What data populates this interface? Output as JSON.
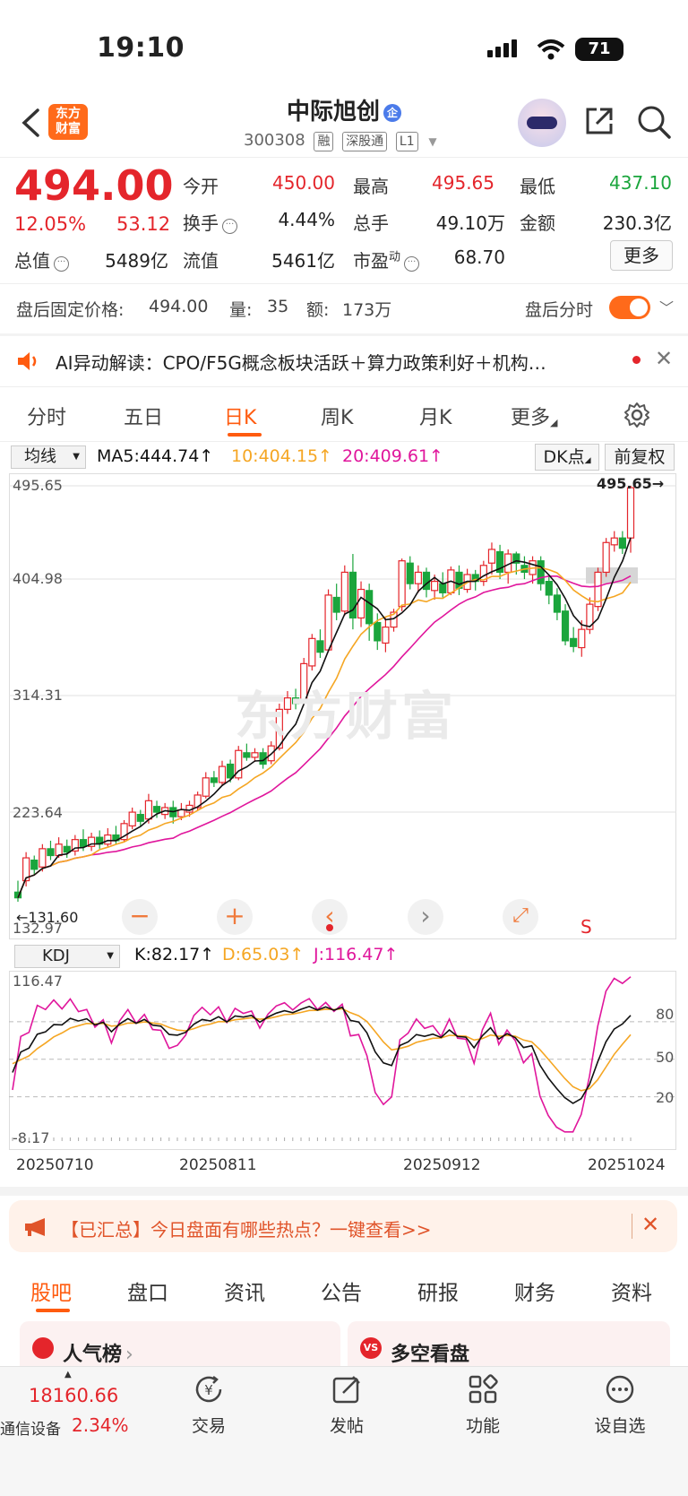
{
  "status_bar": {
    "time": "19:10",
    "battery": "71"
  },
  "header": {
    "stock_name": "中际旭创",
    "badge": "企",
    "code": "300308",
    "tags": [
      "融",
      "深股通",
      "L1"
    ],
    "logo_line1": "东方",
    "logo_line2": "财富"
  },
  "quote": {
    "price": "494.00",
    "change_pct": "12.05%",
    "change": "53.12",
    "open_label": "今开",
    "open": "450.00",
    "high_label": "最高",
    "high": "495.65",
    "low_label": "最低",
    "low": "437.10",
    "turnover_label": "换手",
    "turnover": "4.44%",
    "volume_label": "总手",
    "volume": "49.10万",
    "amount_label": "金额",
    "amount": "230.3亿",
    "mktcap_label": "总值",
    "mktcap": "5489亿",
    "float_label": "流值",
    "float": "5461亿",
    "pe_label": "市盈",
    "pe_sup": "动",
    "pe": "68.70",
    "more_button": "更多"
  },
  "after_hours": {
    "price_label": "盘后固定价格:",
    "price": "494.00",
    "vol_label": "量:",
    "vol": "35",
    "amt_label": "额:",
    "amt": "173万",
    "toggle_label": "盘后分时"
  },
  "ai_bar": {
    "text": "AI异动解读：CPO/F5G概念板块活跃＋算力政策利好＋机构…"
  },
  "chart_tabs": [
    "分时",
    "五日",
    "日K",
    "周K",
    "月K",
    "更多"
  ],
  "chart_header": {
    "ma_select": "均线",
    "ma5": "MA5:444.74↑",
    "ma10": "10:404.15↑",
    "ma20": "20:409.61↑",
    "dk_button": "DK点",
    "adjust_button": "前复权"
  },
  "price_axis": [
    "495.65",
    "404.98",
    "314.31",
    "223.64",
    "132.97"
  ],
  "high_marker": "495.65→",
  "low_marker": "←131.60",
  "watermark": "东方财富",
  "s_marker": "S",
  "kdj_header": {
    "select": "KDJ",
    "k": "K:82.17↑",
    "d": "D:65.03↑",
    "j": "J:116.47↑"
  },
  "kdj_axis": {
    "top": "116.47",
    "bottom": "-8.17",
    "levels": [
      "80",
      "50",
      "20"
    ]
  },
  "dates": [
    "20250710",
    "20250811",
    "20250912",
    "20251024"
  ],
  "banner": {
    "text": "【已汇总】今日盘面有哪些热点？一键查看>>"
  },
  "bottom_tabs": [
    "股吧",
    "盘口",
    "资讯",
    "公告",
    "研报",
    "财务",
    "资料"
  ],
  "cards": {
    "left": "人气榜",
    "right": "多空看盘"
  },
  "bottom_nav": {
    "index_value": "18160.66",
    "index_name": "通信设备",
    "index_pct": "2.34%",
    "items": [
      "交易",
      "发帖",
      "功能",
      "设自选"
    ]
  },
  "colors": {
    "up": "#e4252b",
    "down": "#1aa53c",
    "accent": "#ff5b0f",
    "ma5": "#111111",
    "ma10": "#f5a623",
    "ma20": "#e0169c"
  },
  "chart_data": {
    "type": "candlestick",
    "ylim": [
      131.6,
      495.65
    ],
    "candles": [
      {
        "o": 140,
        "c": 135,
        "h": 150,
        "l": 131.6
      },
      {
        "o": 150,
        "c": 170,
        "h": 175,
        "l": 145
      },
      {
        "o": 168,
        "c": 160,
        "h": 172,
        "l": 155
      },
      {
        "o": 162,
        "c": 178,
        "h": 182,
        "l": 158
      },
      {
        "o": 178,
        "c": 172,
        "h": 185,
        "l": 168
      },
      {
        "o": 172,
        "c": 182,
        "h": 188,
        "l": 170
      },
      {
        "o": 180,
        "c": 175,
        "h": 186,
        "l": 170
      },
      {
        "o": 176,
        "c": 186,
        "h": 190,
        "l": 172
      },
      {
        "o": 186,
        "c": 180,
        "h": 195,
        "l": 176
      },
      {
        "o": 180,
        "c": 188,
        "h": 192,
        "l": 176
      },
      {
        "o": 188,
        "c": 182,
        "h": 194,
        "l": 178
      },
      {
        "o": 182,
        "c": 190,
        "h": 196,
        "l": 180
      },
      {
        "o": 190,
        "c": 185,
        "h": 198,
        "l": 182
      },
      {
        "o": 186,
        "c": 200,
        "h": 203,
        "l": 184
      },
      {
        "o": 198,
        "c": 210,
        "h": 214,
        "l": 195
      },
      {
        "o": 208,
        "c": 202,
        "h": 212,
        "l": 198
      },
      {
        "o": 204,
        "c": 220,
        "h": 226,
        "l": 200
      },
      {
        "o": 215,
        "c": 210,
        "h": 220,
        "l": 205
      },
      {
        "o": 208,
        "c": 214,
        "h": 218,
        "l": 204
      },
      {
        "o": 214,
        "c": 206,
        "h": 220,
        "l": 200
      },
      {
        "o": 206,
        "c": 212,
        "h": 218,
        "l": 203
      },
      {
        "o": 210,
        "c": 216,
        "h": 220,
        "l": 206
      },
      {
        "o": 214,
        "c": 225,
        "h": 228,
        "l": 212
      },
      {
        "o": 224,
        "c": 240,
        "h": 245,
        "l": 222
      },
      {
        "o": 240,
        "c": 236,
        "h": 246,
        "l": 232
      },
      {
        "o": 236,
        "c": 250,
        "h": 255,
        "l": 234
      },
      {
        "o": 252,
        "c": 240,
        "h": 256,
        "l": 236
      },
      {
        "o": 240,
        "c": 264,
        "h": 268,
        "l": 238
      },
      {
        "o": 262,
        "c": 258,
        "h": 270,
        "l": 255
      },
      {
        "o": 258,
        "c": 262,
        "h": 266,
        "l": 254
      },
      {
        "o": 262,
        "c": 252,
        "h": 266,
        "l": 248
      },
      {
        "o": 255,
        "c": 268,
        "h": 272,
        "l": 252
      },
      {
        "o": 266,
        "c": 300,
        "h": 305,
        "l": 264
      },
      {
        "o": 300,
        "c": 310,
        "h": 316,
        "l": 296
      },
      {
        "o": 310,
        "c": 305,
        "h": 318,
        "l": 300
      },
      {
        "o": 306,
        "c": 340,
        "h": 345,
        "l": 304
      },
      {
        "o": 338,
        "c": 362,
        "h": 366,
        "l": 334
      },
      {
        "o": 360,
        "c": 350,
        "h": 370,
        "l": 345
      },
      {
        "o": 352,
        "c": 400,
        "h": 405,
        "l": 350
      },
      {
        "o": 398,
        "c": 385,
        "h": 410,
        "l": 378
      },
      {
        "o": 386,
        "c": 420,
        "h": 426,
        "l": 382
      },
      {
        "o": 420,
        "c": 380,
        "h": 436,
        "l": 370
      },
      {
        "o": 380,
        "c": 405,
        "h": 412,
        "l": 372
      },
      {
        "o": 404,
        "c": 375,
        "h": 410,
        "l": 360
      },
      {
        "o": 376,
        "c": 360,
        "h": 384,
        "l": 352
      },
      {
        "o": 358,
        "c": 372,
        "h": 380,
        "l": 350
      },
      {
        "o": 372,
        "c": 385,
        "h": 388,
        "l": 368
      },
      {
        "o": 390,
        "c": 430,
        "h": 432,
        "l": 386
      },
      {
        "o": 428,
        "c": 410,
        "h": 434,
        "l": 405
      },
      {
        "o": 410,
        "c": 420,
        "h": 426,
        "l": 402
      },
      {
        "o": 420,
        "c": 405,
        "h": 424,
        "l": 398
      },
      {
        "o": 404,
        "c": 412,
        "h": 418,
        "l": 396
      },
      {
        "o": 410,
        "c": 402,
        "h": 420,
        "l": 398
      },
      {
        "o": 402,
        "c": 422,
        "h": 425,
        "l": 400
      },
      {
        "o": 420,
        "c": 406,
        "h": 426,
        "l": 400
      },
      {
        "o": 405,
        "c": 418,
        "h": 423,
        "l": 402
      },
      {
        "o": 418,
        "c": 412,
        "h": 422,
        "l": 404
      },
      {
        "o": 412,
        "c": 426,
        "h": 430,
        "l": 408
      },
      {
        "o": 428,
        "c": 440,
        "h": 446,
        "l": 418
      },
      {
        "o": 438,
        "c": 420,
        "h": 444,
        "l": 414
      },
      {
        "o": 420,
        "c": 436,
        "h": 440,
        "l": 410
      },
      {
        "o": 436,
        "c": 428,
        "h": 438,
        "l": 418
      },
      {
        "o": 426,
        "c": 420,
        "h": 434,
        "l": 414
      },
      {
        "o": 418,
        "c": 430,
        "h": 434,
        "l": 410
      },
      {
        "o": 430,
        "c": 410,
        "h": 434,
        "l": 404
      },
      {
        "o": 412,
        "c": 400,
        "h": 418,
        "l": 392
      },
      {
        "o": 400,
        "c": 385,
        "h": 406,
        "l": 378
      },
      {
        "o": 386,
        "c": 360,
        "h": 392,
        "l": 356
      },
      {
        "o": 362,
        "c": 355,
        "h": 372,
        "l": 350
      },
      {
        "o": 354,
        "c": 370,
        "h": 378,
        "l": 346
      },
      {
        "o": 370,
        "c": 392,
        "h": 398,
        "l": 366
      },
      {
        "o": 390,
        "c": 420,
        "h": 424,
        "l": 386
      },
      {
        "o": 420,
        "c": 446,
        "h": 450,
        "l": 416
      },
      {
        "o": 444,
        "c": 450,
        "h": 456,
        "l": 438
      },
      {
        "o": 450,
        "c": 441,
        "h": 456,
        "l": 436
      },
      {
        "o": 450,
        "c": 494,
        "h": 495.65,
        "l": 437.1
      }
    ]
  }
}
